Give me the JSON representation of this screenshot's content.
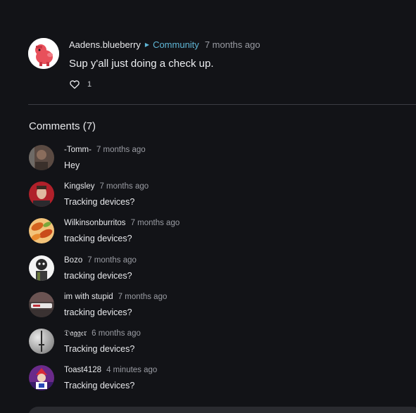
{
  "post": {
    "author": "Aadens.blueberry",
    "community": "Community",
    "time": "7 months ago",
    "text": "Sup y'all just doing a check up.",
    "likes": "1"
  },
  "comments_section": {
    "heading": "Comments",
    "count": "(7)"
  },
  "comments": [
    {
      "author": "-Tomm-",
      "time": "7 months ago",
      "text": "Hey"
    },
    {
      "author": "Kingsley",
      "time": "7 months ago",
      "text": "Tracking devices?"
    },
    {
      "author": "Wilkinsonburritos",
      "time": "7 months ago",
      "text": "tracking devices?"
    },
    {
      "author": "Bozo",
      "time": "7 months ago",
      "text": "tracking devices?"
    },
    {
      "author": "im with stupid",
      "time": "7 months ago",
      "text": "tracking devices?"
    },
    {
      "author": "𝔇𝔞𝔤𝔤𝔢𝔯",
      "time": "6 months ago",
      "text": "Tracking devices?"
    },
    {
      "author": "Toast4128",
      "time": "4 minutes ago",
      "text": "Tracking devices?"
    }
  ],
  "icons": {
    "like": "heart-outline-icon",
    "community_separator": "triangle-right-icon"
  },
  "colors": {
    "background": "#121317",
    "link": "#5fb6d6",
    "muted": "#9a9ca3",
    "divider": "#3b3d43"
  }
}
